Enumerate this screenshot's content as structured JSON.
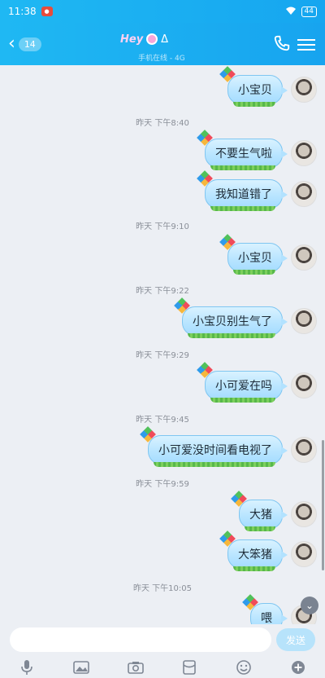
{
  "status": {
    "time": "11:38",
    "battery": "44"
  },
  "header": {
    "unread_count": "14",
    "title_logo": "Hey",
    "title_tail": "Δ",
    "subtitle": "手机在线 - 4G"
  },
  "messages": [
    {
      "text": "小宝贝"
    },
    {
      "timestamp": "昨天 下午8:40"
    },
    {
      "text": "不要生气啦"
    },
    {
      "text": "我知道错了"
    },
    {
      "timestamp": "昨天 下午9:10"
    },
    {
      "text": "小宝贝"
    },
    {
      "timestamp": "昨天 下午9:22"
    },
    {
      "text": "小宝贝别生气了"
    },
    {
      "timestamp": "昨天 下午9:29"
    },
    {
      "text": "小可爱在吗"
    },
    {
      "timestamp": "昨天 下午9:45"
    },
    {
      "text": "小可爱没时间看电视了"
    },
    {
      "timestamp": "昨天 下午9:59"
    },
    {
      "text": "大猪"
    },
    {
      "text": "大笨猪"
    },
    {
      "timestamp": "昨天 下午10:05"
    },
    {
      "text": "喂"
    }
  ],
  "input": {
    "placeholder": "",
    "value": "",
    "send_label": "发送"
  },
  "toolbar": {
    "icons": [
      "mic-icon",
      "image-icon",
      "camera-icon",
      "red-packet-icon",
      "emoji-icon",
      "plus-icon"
    ]
  },
  "colors": {
    "header": "#1fb8f3",
    "bubble": "#b9e5ff",
    "background": "#eceff4"
  }
}
